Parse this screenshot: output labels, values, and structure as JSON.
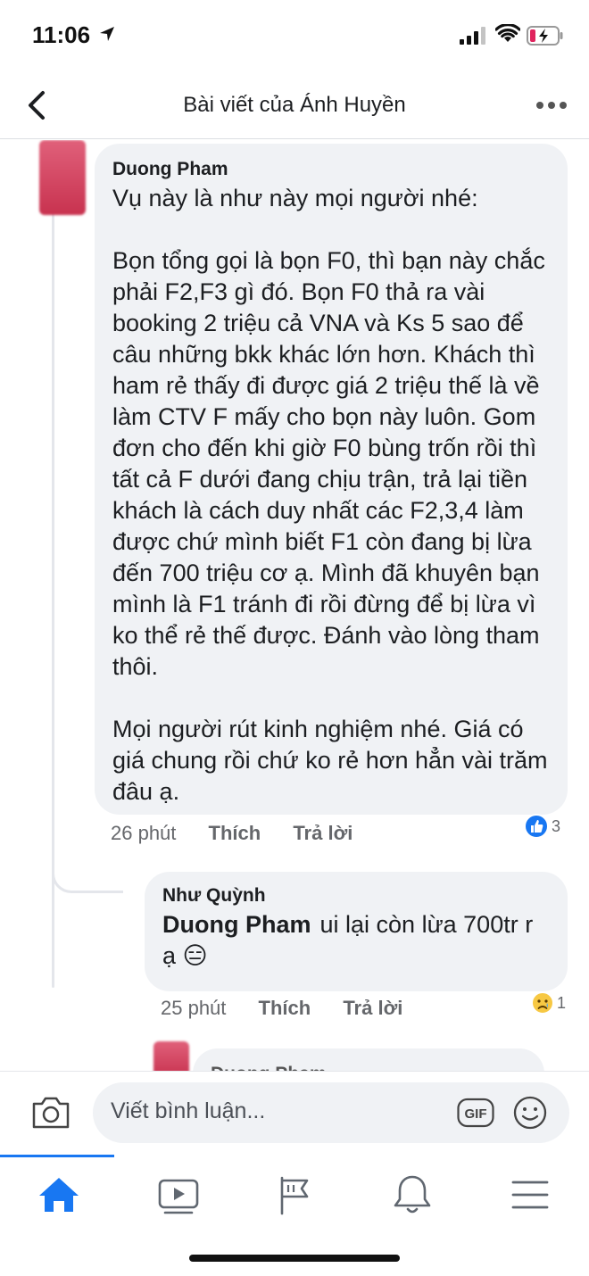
{
  "status_bar": {
    "time": "11:06"
  },
  "header": {
    "title": "Bài viết của Ánh Huyền"
  },
  "comments": [
    {
      "author": "Duong Pham",
      "paragraphs": [
        "Vụ này là như này mọi người nhé:",
        "Bọn tổng gọi là bọn F0, thì bạn này chắc phải F2,F3 gì đó. Bọn F0 thả ra vài booking 2 triệu cả VNA và Ks 5 sao để câu những bkk khác lớn hơn. Khách thì ham rẻ thấy đi được giá 2 triệu thế là về làm CTV F mấy cho bọn này luôn. Gom đơn cho đến khi giờ F0 bùng trốn rồi thì tất cả F dưới đang chịu trận, trả lại tiền khách là cách duy nhất các F2,3,4 làm được chứ mình biết F1 còn đang bị lừa đến 700 triệu cơ ạ. Mình đã khuyên bạn mình là F1 tránh đi rồi đừng để bị lừa vì ko thể rẻ thế được. Đánh vào lòng tham thôi.",
        "Mọi người rút kinh nghiệm nhé. Giá có giá chung rồi chứ ko rẻ hơn hẳn vài trăm đâu ạ."
      ],
      "time": "26 phút",
      "like_label": "Thích",
      "reply_label": "Trả lời",
      "reaction_icon": "thumbs-up-icon",
      "reaction_count": "3"
    },
    {
      "author": "Như Quỳnh",
      "mention": "Duong Pham",
      "text": "ui lại còn lừa 700tr r ạ",
      "emoji": "😑",
      "time": "25 phút",
      "like_label": "Thích",
      "reply_label": "Trả lời",
      "reaction_icon": "sad-face-icon",
      "reaction_count": "1"
    },
    {
      "author": "Duong Pham"
    }
  ],
  "composer": {
    "placeholder": "Viết bình luận...",
    "gif_label": "GIF"
  },
  "tabs": [
    "home-icon",
    "video-icon",
    "pages-flag-icon",
    "notifications-bell-icon",
    "menu-icon"
  ],
  "colors": {
    "accent": "#1877f2",
    "bubble": "#f0f2f5",
    "meta_text": "#65676b"
  }
}
